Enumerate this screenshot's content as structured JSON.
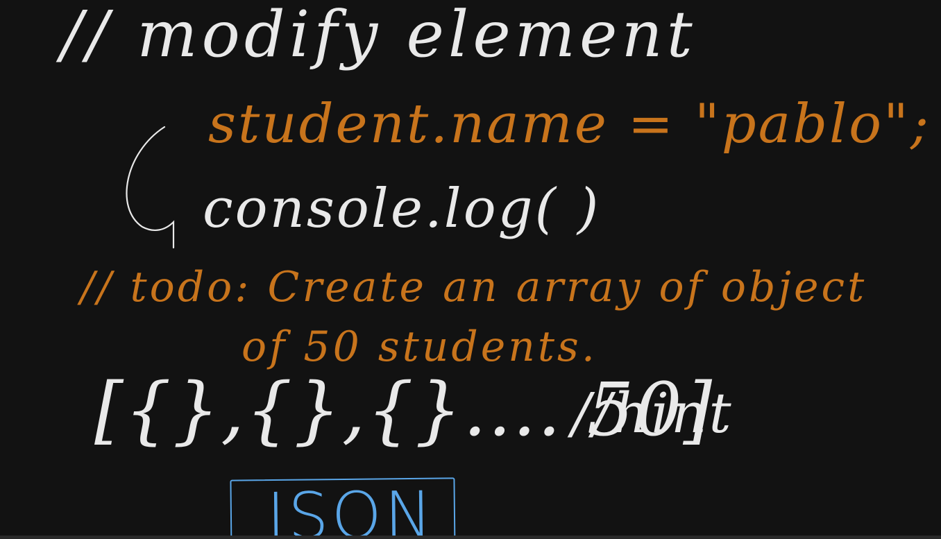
{
  "notes": {
    "line_1": "// modify element",
    "line_2": "student.name = \"pablo\";",
    "line_3": "console.log( )",
    "line_4": "// todo: Create an array of object",
    "line_5": "of 50 students.",
    "line_6": "[{},{},{}.... 50]",
    "line_6_comment": "//hint",
    "json_label": "JSON"
  },
  "colors": {
    "background": "#121212",
    "white_ink": "#e9e9e9",
    "orange_ink": "#c8741c",
    "blue_ink": "#5aa6e8"
  }
}
